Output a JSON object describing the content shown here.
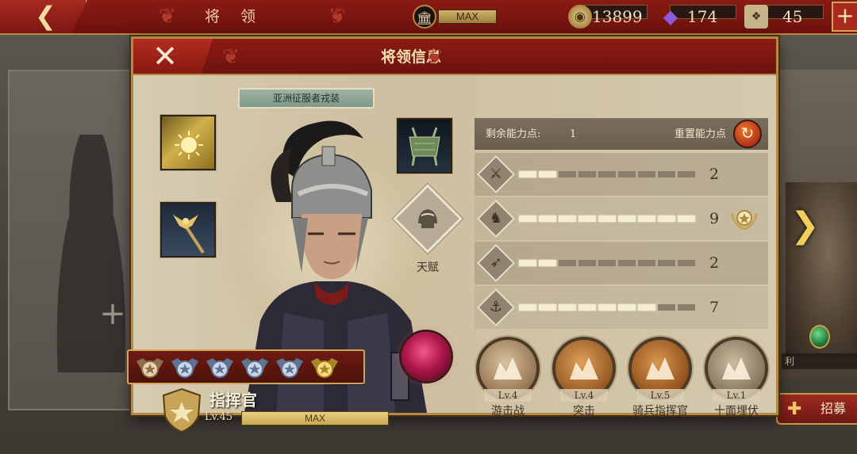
{
  "top_bar": {
    "title": "将 领",
    "temple_status": "MAX",
    "coins": "13899",
    "gems": "174",
    "tokens": "45",
    "accent": "#8a1b15"
  },
  "dialog": {
    "title": "将领信息",
    "outfit_label": "亚洲征服者戎装",
    "talent_label": "天赋",
    "commander": {
      "name": "指挥官",
      "level": "Lv.45",
      "xp_status": "MAX",
      "rank_badges": [
        "bronze",
        "silver",
        "silver",
        "silver",
        "silver",
        "gold"
      ]
    },
    "stats": {
      "points_label": "剩余能力点:",
      "points_value": "1",
      "reset_label": "重置能力点",
      "rows": [
        {
          "icon": "sword-icon",
          "glyph": "⚔",
          "value": "2",
          "filled": 2,
          "total": 9
        },
        {
          "icon": "horse-icon",
          "glyph": "♞",
          "value": "9",
          "filled": 9,
          "total": 9,
          "medal": true
        },
        {
          "icon": "bow-icon",
          "glyph": "➶",
          "value": "2",
          "filled": 2,
          "total": 9
        },
        {
          "icon": "anchor-icon",
          "glyph": "⚓",
          "value": "7",
          "filled": 7,
          "total": 9
        }
      ]
    },
    "skills": [
      {
        "level": "Lv.4",
        "name": "游击战",
        "colors": [
          "#d8c3a0",
          "#8b6a46"
        ]
      },
      {
        "level": "Lv.4",
        "name": "突击",
        "colors": [
          "#e0a05a",
          "#8a4e1c"
        ]
      },
      {
        "level": "Lv.5",
        "name": "骑兵指挥官",
        "colors": [
          "#d9984f",
          "#874716"
        ]
      },
      {
        "level": "Lv.1",
        "name": "十面埋伏",
        "colors": [
          "#cbbca0",
          "#7d6a50"
        ]
      }
    ]
  },
  "side": {
    "right_label": "利",
    "recruit_label": "招募"
  }
}
